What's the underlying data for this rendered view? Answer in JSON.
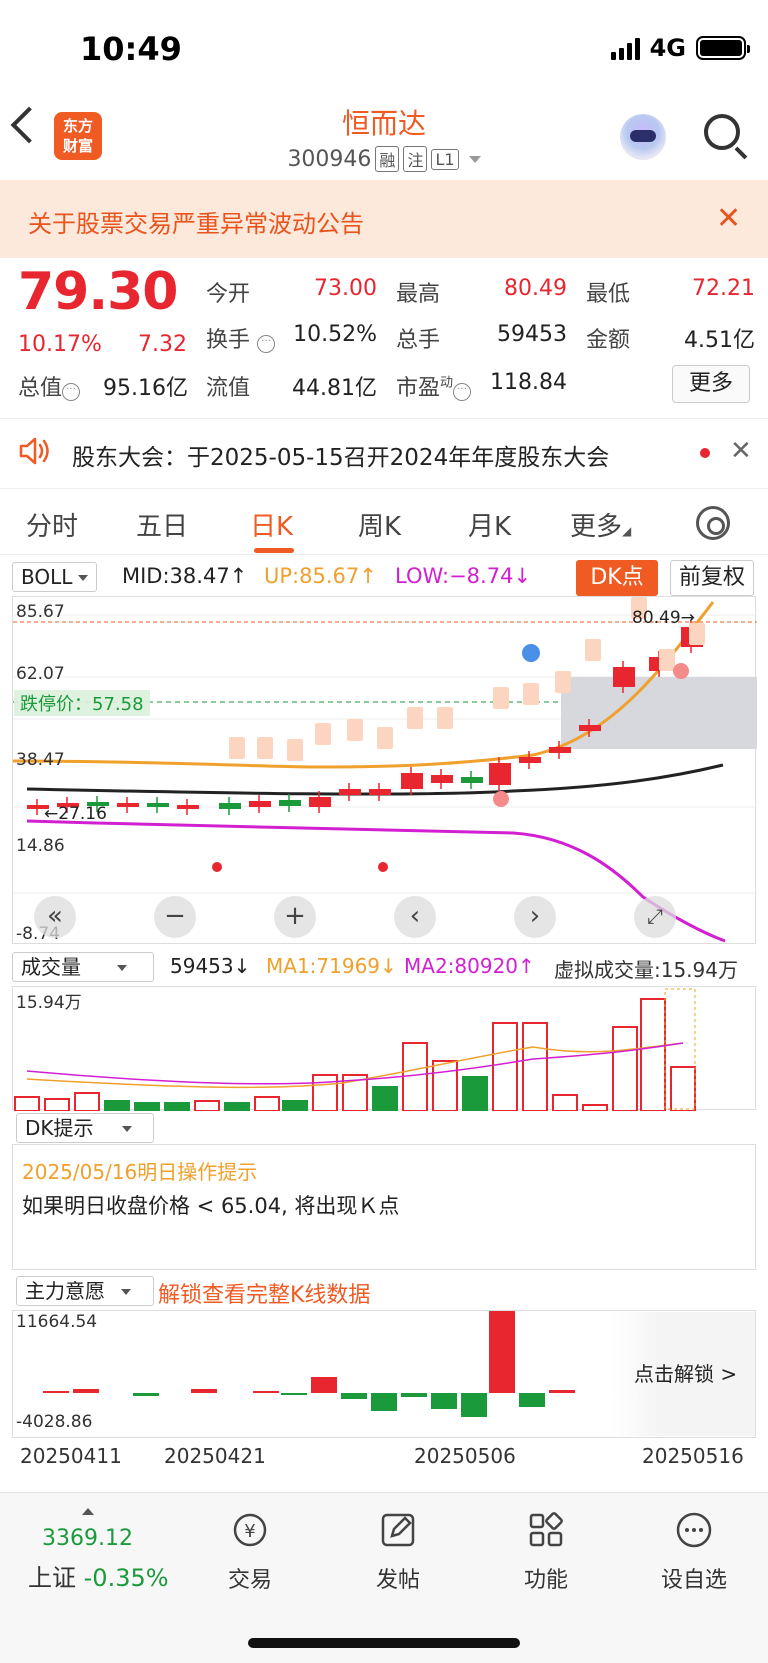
{
  "status": {
    "time": "10:49",
    "network": "4G"
  },
  "header": {
    "logo_line1": "东方",
    "logo_line2": "财富",
    "stock_name": "恒而达",
    "stock_code": "300946",
    "tags": [
      "融",
      "注",
      "L1"
    ]
  },
  "announcement": {
    "text": "关于股票交易严重异常波动公告"
  },
  "quote": {
    "price": "79.30",
    "change_pct": "10.17%",
    "change_amt": "7.32",
    "open_label": "今开",
    "open": "73.00",
    "high_label": "最高",
    "high": "80.49",
    "low_label": "最低",
    "low": "72.21",
    "turnover_label": "换手",
    "turnover": "10.52%",
    "volume_label": "总手",
    "volume": "59453",
    "amount_label": "金额",
    "amount": "4.51亿",
    "mcap_label": "总值",
    "mcap": "95.16亿",
    "float_label": "流值",
    "float": "44.81亿",
    "pe_label": "市盈",
    "pe_sup": "动",
    "pe": "118.84",
    "more_label": "更多"
  },
  "shareholder": {
    "text": "股东大会：于2025-05-15召开2024年年度股东大会"
  },
  "tabs": [
    "分时",
    "五日",
    "日K",
    "周K",
    "月K",
    "更多"
  ],
  "active_tab": "日K",
  "boll": {
    "name": "BOLL",
    "mid": "MID:38.47↑",
    "up": "UP:85.67↑",
    "low": "LOW:−8.74↓",
    "dk_button": "DK点",
    "adjust_button": "前复权",
    "y_labels": [
      "85.67",
      "62.07",
      "38.47",
      "14.86",
      "-8.74"
    ],
    "limit_down_label": "跌停价：57.58",
    "high_annot": "80.49→",
    "low_annot": "←27.16",
    "colors": {
      "up": "#f0a02c",
      "mid": "#222222",
      "low": "#d21fd2",
      "rise": "#e8262f",
      "fall": "#1a9a3a"
    }
  },
  "volume": {
    "name": "成交量",
    "value": "59453↓",
    "ma1": "MA1:71969↓",
    "ma2": "MA2:80920↑",
    "virtual": "虚拟成交量:15.94万",
    "y_top": "15.94万"
  },
  "dk_hint": {
    "name": "DK提示",
    "date_line": "2025/05/16明日操作提示",
    "message": "如果明日收盘价格 < 65.04, 将出现Ｋ点"
  },
  "main_force": {
    "name": "主力意愿",
    "unlock_link": "解锁查看完整K线数据",
    "y_top": "11664.54",
    "y_bottom": "-4028.86",
    "unlock_button": "点击解锁 >"
  },
  "dates": [
    "20250411",
    "20250421",
    "20250506",
    "20250516"
  ],
  "bottom": {
    "index_value": "3369.12",
    "index_name": "上证",
    "index_change": "-0.35%",
    "items": [
      "交易",
      "发帖",
      "功能",
      "设自选"
    ]
  }
}
